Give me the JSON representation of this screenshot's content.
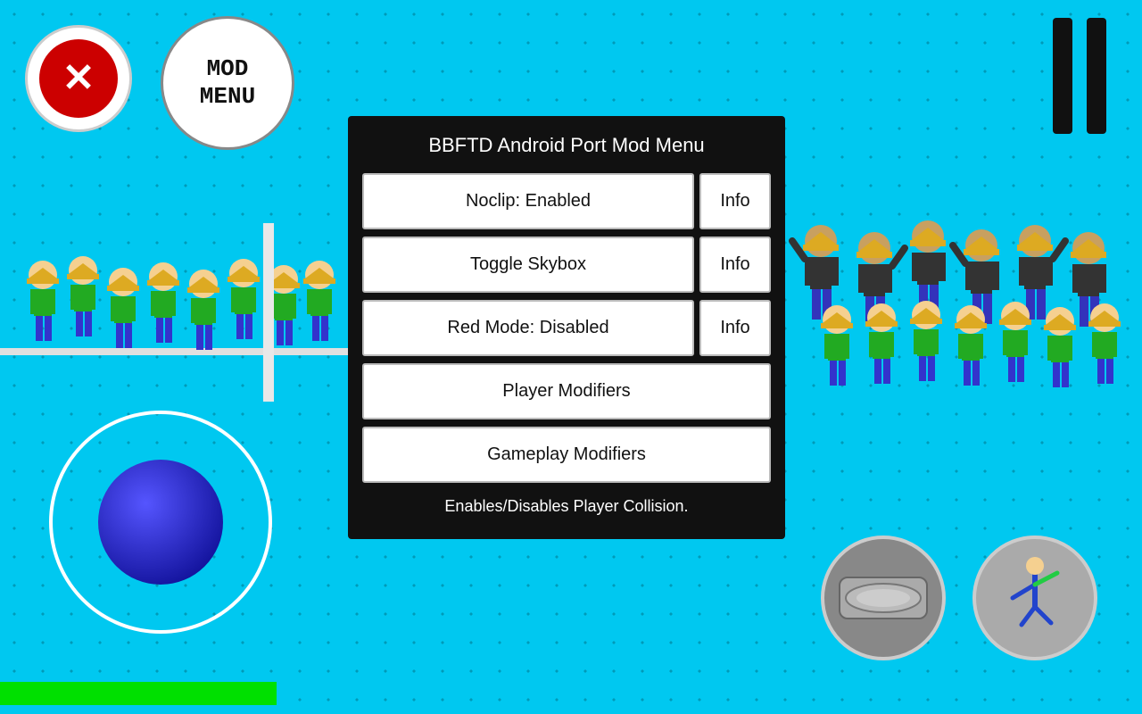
{
  "app": {
    "title": "BBFTD Android Port Mod Menu"
  },
  "buttons": {
    "close_label": "✕",
    "mod_menu_label": "MOD\nMENU",
    "noclip_label": "Noclip: Enabled",
    "noclip_info": "Info",
    "skybox_label": "Toggle Skybox",
    "skybox_info": "Info",
    "redmode_label": "Red Mode: Disabled",
    "redmode_info": "Info",
    "player_mod_label": "Player Modifiers",
    "gameplay_mod_label": "Gameplay Modifiers"
  },
  "description": "Enables/Disables Player Collision.",
  "colors": {
    "bg": "#00c8f0",
    "panel_bg": "#111111",
    "button_bg": "#ffffff",
    "close_red": "#cc0000"
  }
}
